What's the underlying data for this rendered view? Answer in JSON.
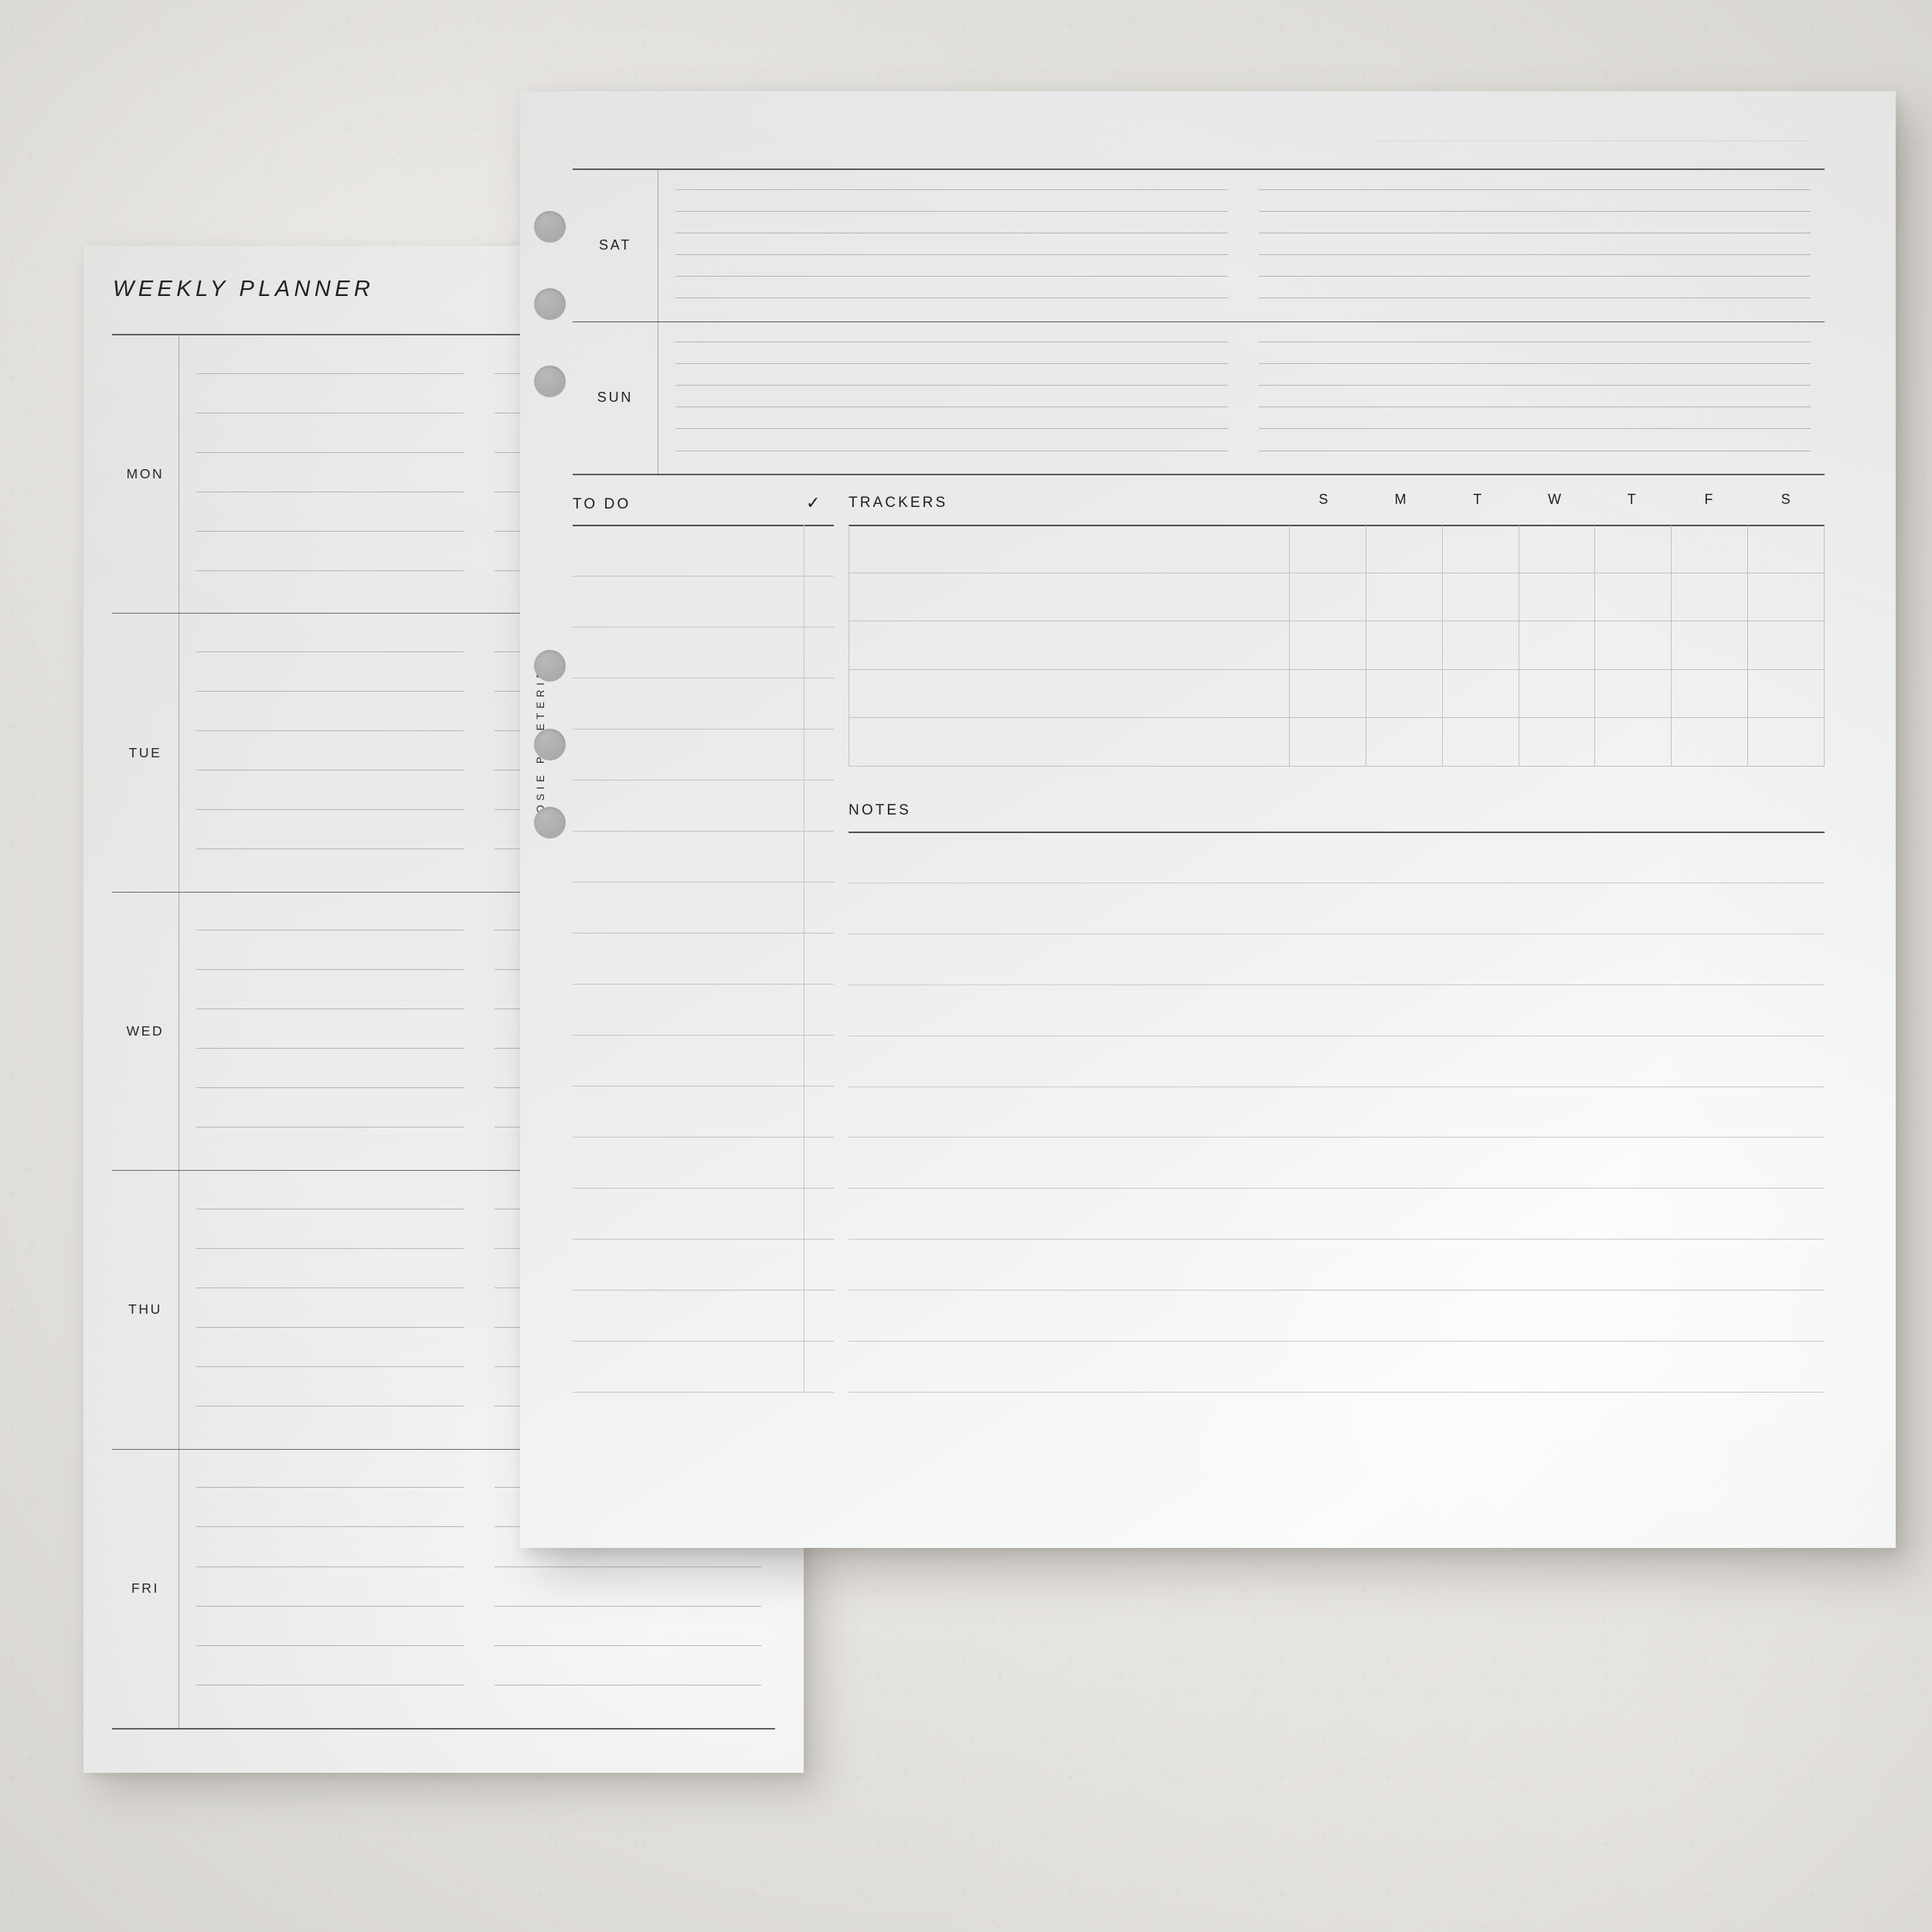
{
  "scene": {
    "background_color": "#e9e7e3",
    "paper_color": "#ececeb"
  },
  "left_page": {
    "title": "WEEKLY PLANNER",
    "columns_per_day": 2,
    "rules_per_column": 6,
    "days": [
      {
        "label": "MON"
      },
      {
        "label": "TUE"
      },
      {
        "label": "WED"
      },
      {
        "label": "THU"
      },
      {
        "label": "FRI"
      }
    ]
  },
  "right_page": {
    "brand": "ROSIE PAPETERIE",
    "hole_punch_count": 6,
    "date_line": "",
    "weekend": {
      "columns_per_day": 2,
      "rules_per_column": 6,
      "days": [
        {
          "label": "SAT"
        },
        {
          "label": "SUN"
        }
      ]
    },
    "todo": {
      "title": "TO DO",
      "check_icon": "✓",
      "line_count": 17
    },
    "trackers": {
      "title": "TRACKERS",
      "day_initials": [
        "S",
        "M",
        "T",
        "W",
        "T",
        "F",
        "S"
      ],
      "row_count": 5,
      "rows": [
        {
          "name": ""
        },
        {
          "name": ""
        },
        {
          "name": ""
        },
        {
          "name": ""
        },
        {
          "name": ""
        }
      ]
    },
    "notes": {
      "title": "NOTES",
      "line_count": 11
    }
  }
}
